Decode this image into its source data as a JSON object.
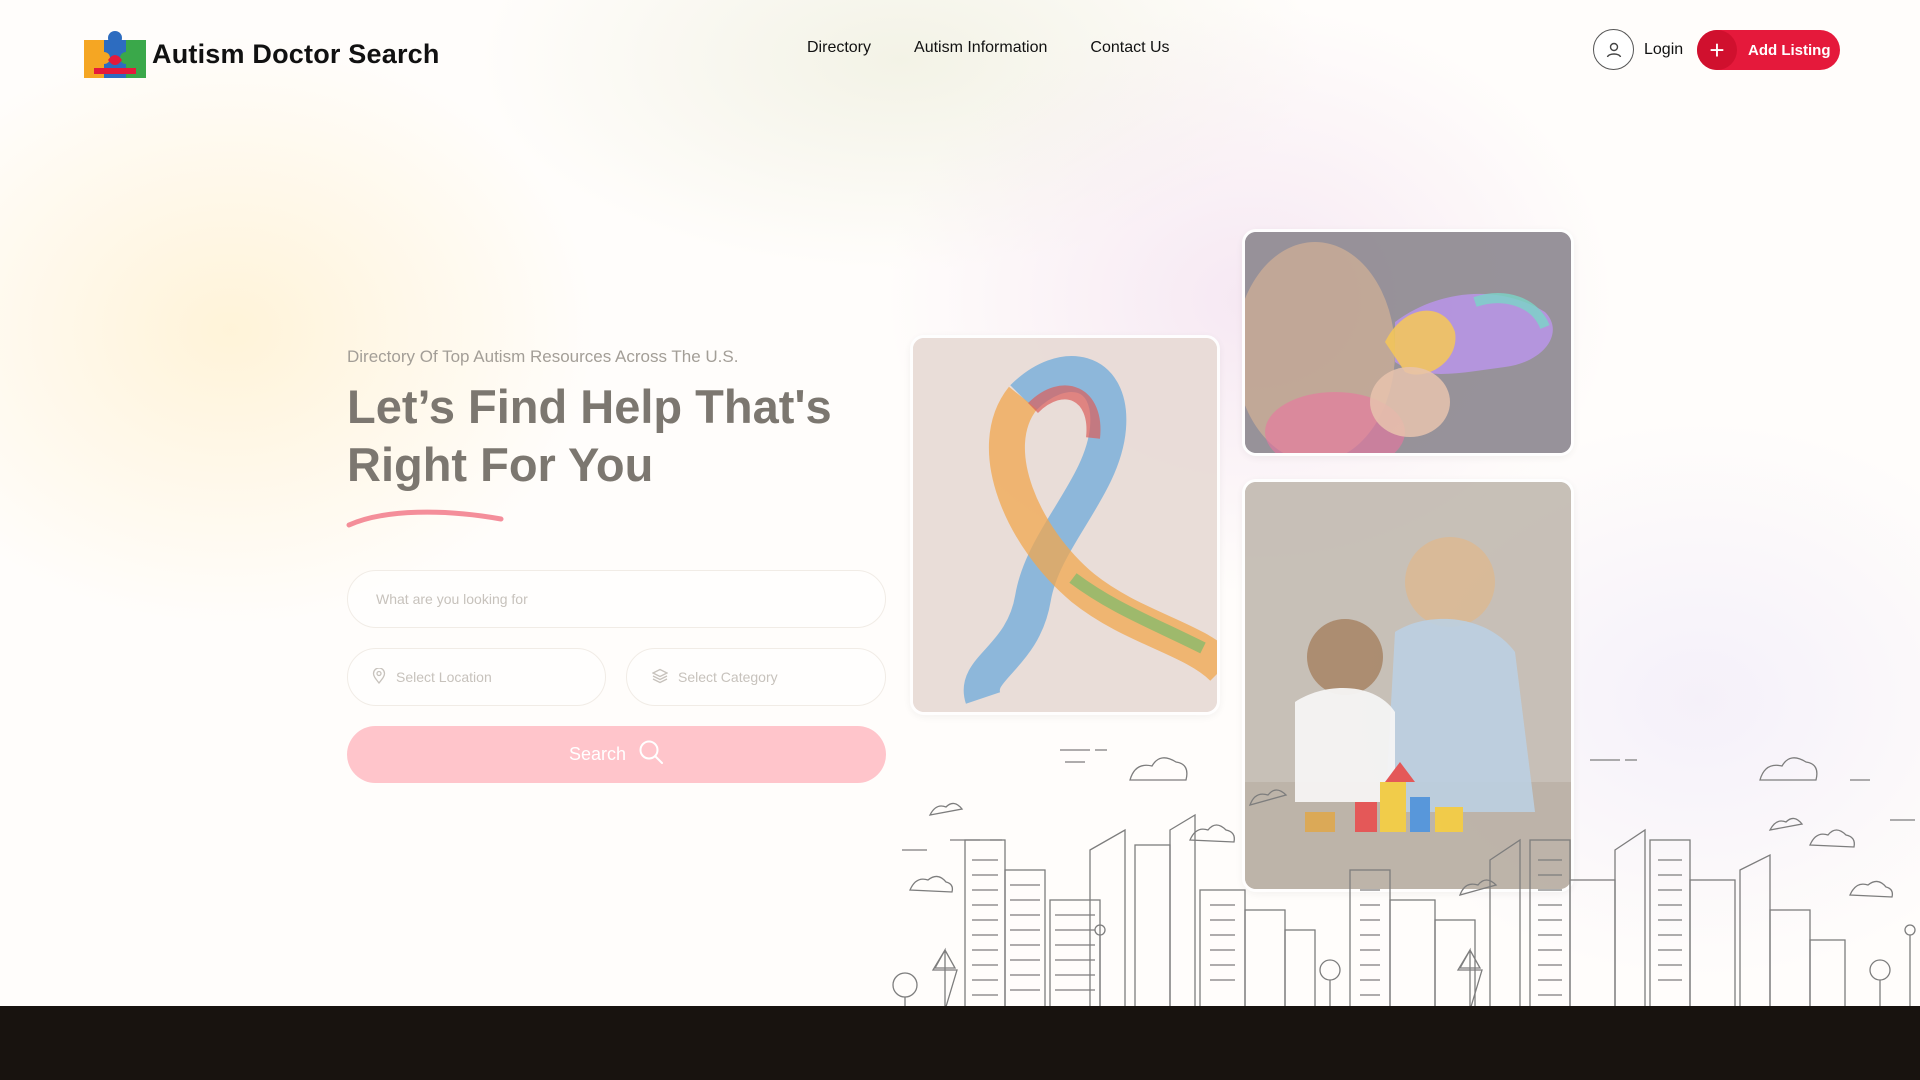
{
  "header": {
    "logo_text": "Autism Doctor Search",
    "nav": [
      {
        "label": "Directory"
      },
      {
        "label": "Autism Information"
      },
      {
        "label": "Contact Us"
      }
    ],
    "login_label": "Login",
    "add_listing_label": "Add Listing"
  },
  "hero": {
    "subtitle": "Directory Of Top Autism Resources Across The U.S.",
    "title": "Let’s Find Help That's Right For You",
    "search_placeholder": "What are you looking for",
    "location_placeholder": "Select Location",
    "category_placeholder": "Select Category",
    "search_button": "Search"
  },
  "colors": {
    "accent": "#e5193b",
    "button_faded": "#ffc5cb",
    "footer": "#18130f"
  },
  "icons": [
    "puzzle-logo-icon",
    "user-icon",
    "plus-icon",
    "map-pin-icon",
    "layers-icon",
    "search-icon"
  ]
}
